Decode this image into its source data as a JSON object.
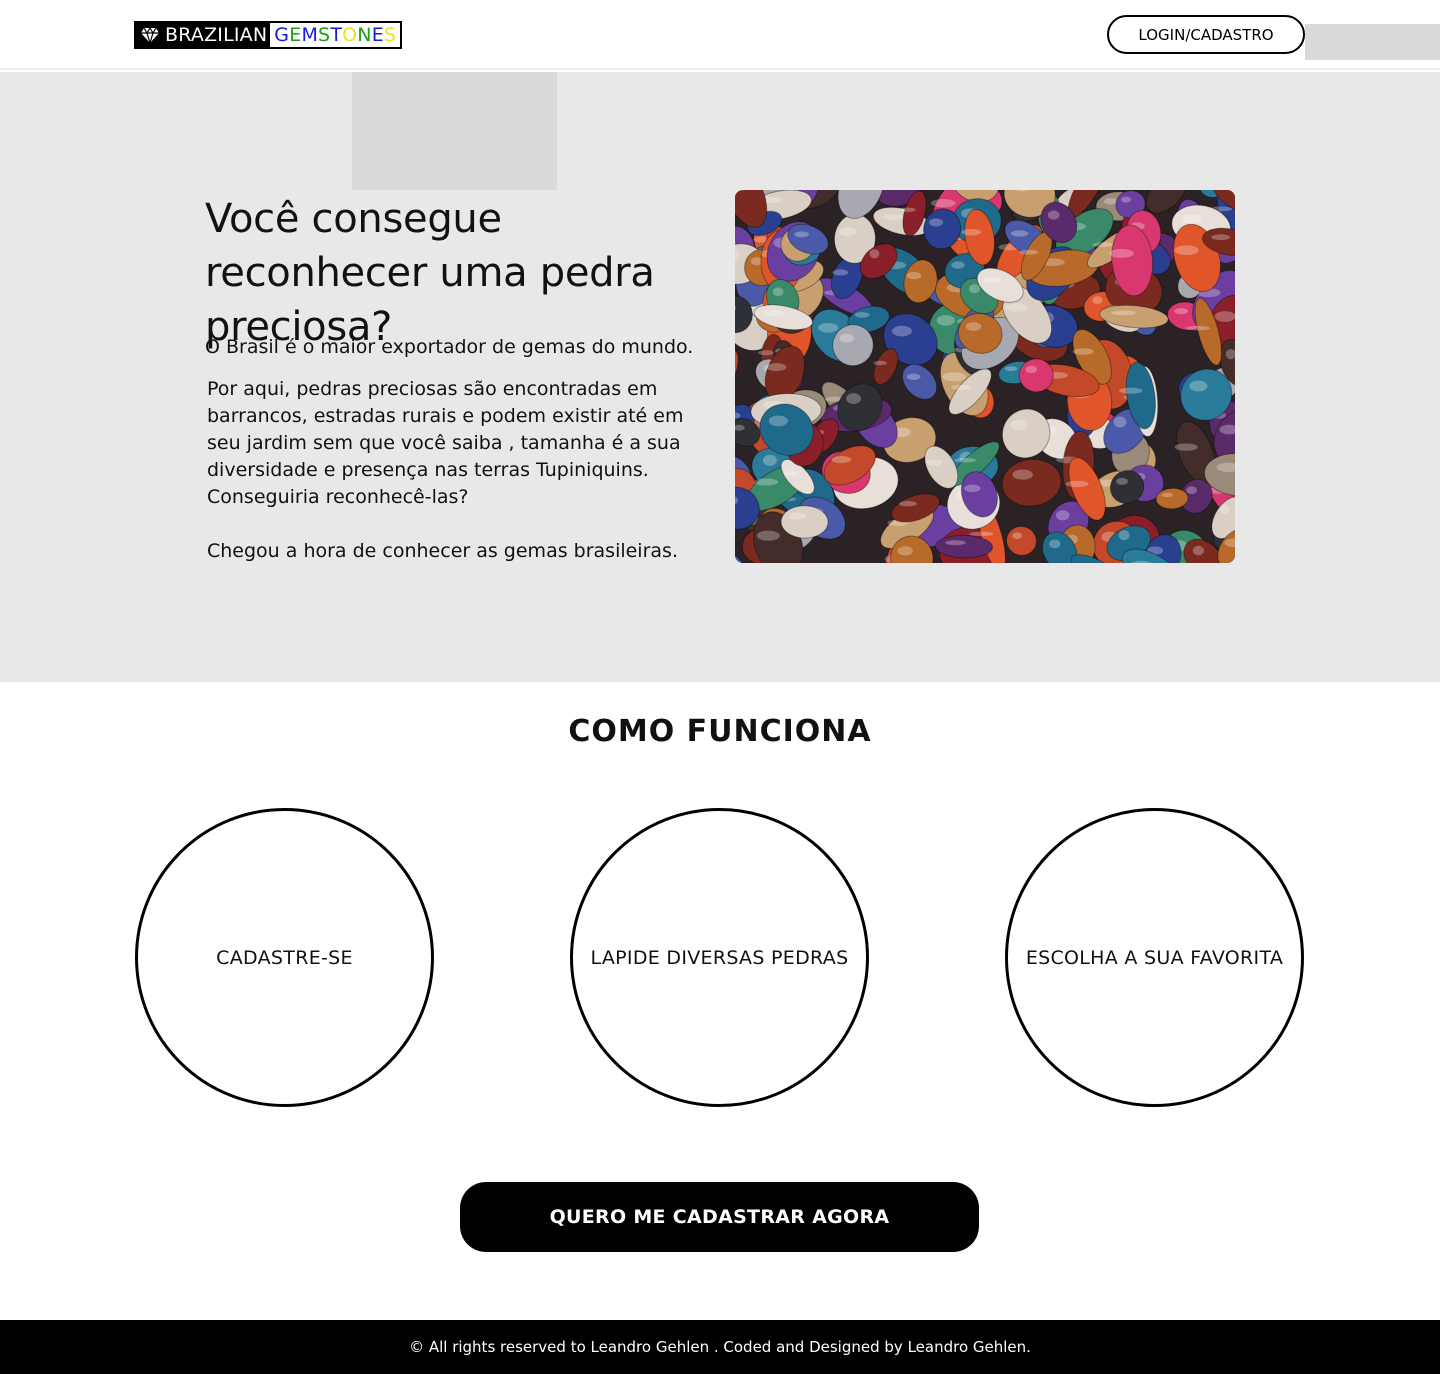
{
  "header": {
    "logo_left": "BRAZILIAN",
    "logo_right_letters": [
      {
        "ch": "G",
        "color": "#1a1adb"
      },
      {
        "ch": "E",
        "color": "#17a017"
      },
      {
        "ch": "M",
        "color": "#1a1adb"
      },
      {
        "ch": "S",
        "color": "#17a017"
      },
      {
        "ch": "T",
        "color": "#1a1adb"
      },
      {
        "ch": "O",
        "color": "#e6e61a"
      },
      {
        "ch": "N",
        "color": "#17a017"
      },
      {
        "ch": "E",
        "color": "#1a1adb"
      },
      {
        "ch": "S",
        "color": "#e6e61a"
      }
    ],
    "login_label": "LOGIN/CADASTRO"
  },
  "hero": {
    "title": "Você consegue reconhecer uma pedra preciosa?",
    "lead": "O Brasil é o maior exportador de gemas do mundo.",
    "body": "Por aqui, pedras preciosas são encontradas em\nbarrancos, estradas rurais e podem existir até em\nseu jardim sem que você saiba , tamanha é a sua\ndiversidade e presença nas terras Tupiniquins.\nConseguiria reconhecê-las?",
    "cta_text": "Chegou a hora de conhecer as gemas brasileiras."
  },
  "how_it_works": {
    "title": "COMO FUNCIONA",
    "steps": [
      "CADASTRE-SE",
      "LAPIDE DIVERSAS PEDRAS",
      "ESCOLHA A SUA FAVORITA"
    ]
  },
  "cta_button": "QUERO ME CADASTRAR AGORA",
  "footer": {
    "text": "© All rights reserved to Leandro Gehlen . Coded  and Designed by Leandro Gehlen."
  },
  "colors": {
    "hero_bg": "#e8e8e8",
    "placeholder": "#d9d9d9",
    "button_bg": "#000000",
    "footer_bg": "#000000"
  }
}
